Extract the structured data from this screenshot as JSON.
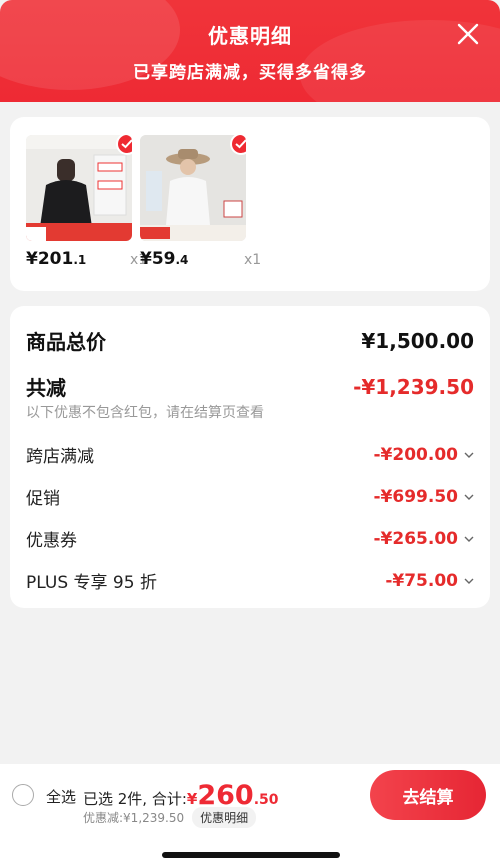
{
  "header": {
    "title": "优惠明细",
    "subtitle": "已享跨店满减，买得多省得多"
  },
  "products": [
    {
      "price_int": "¥201",
      "price_dec": ".1",
      "qty": "x1"
    },
    {
      "price_int": "¥59",
      "price_dec": ".4",
      "qty": "x1"
    }
  ],
  "summary": {
    "total_label": "商品总价",
    "total_value": "¥1,500.00",
    "reduce_label": "共减",
    "reduce_value": "-¥1,239.50",
    "note": "以下优惠不包含红包，请在结算页查看",
    "items": [
      {
        "label": "跨店满减",
        "value": "-¥200.00"
      },
      {
        "label": "促销",
        "value": "-¥699.50"
      },
      {
        "label": "优惠券",
        "value": "-¥265.00"
      },
      {
        "label": "PLUS 专享 95 折",
        "value": "-¥75.00"
      }
    ]
  },
  "bottom": {
    "select_all": "全选",
    "selected_text": "已选 2件, 合计:",
    "currency": "¥",
    "total_int": "260",
    "total_dec": ".50",
    "discount_text": "优惠减:¥1,239.50",
    "detail_btn": "优惠明细",
    "checkout": "去结算"
  },
  "colors": {
    "accent": "#ee2a34",
    "price_red": "#e52b2b",
    "background": "#f2f2f2"
  },
  "icons": {
    "close": "close-icon",
    "check": "check-icon",
    "chevron": "chevron-down-icon"
  }
}
